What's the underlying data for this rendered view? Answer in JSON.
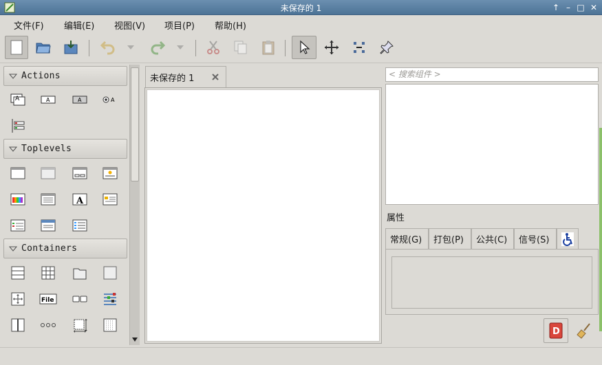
{
  "window": {
    "title": "未保存的 1"
  },
  "menubar": {
    "items": [
      {
        "label": "文件(F)"
      },
      {
        "label": "编辑(E)"
      },
      {
        "label": "视图(V)"
      },
      {
        "label": "项目(P)"
      },
      {
        "label": "帮助(H)"
      }
    ]
  },
  "palette": {
    "groups": [
      {
        "label": "Actions"
      },
      {
        "label": "Toplevels"
      },
      {
        "label": "Containers"
      }
    ]
  },
  "document": {
    "tab_label": "未保存的 1"
  },
  "inspector": {
    "search_placeholder": "< 搜索组件 >",
    "properties_title": "属性",
    "tabs": [
      {
        "label": "常规(G)"
      },
      {
        "label": "打包(P)"
      },
      {
        "label": "公共(C)"
      },
      {
        "label": "信号(S)"
      }
    ]
  },
  "colors": {
    "titlebar": "#5a7fa3",
    "window_bg": "#dcdad5",
    "accent_green": "#8cc06a"
  }
}
